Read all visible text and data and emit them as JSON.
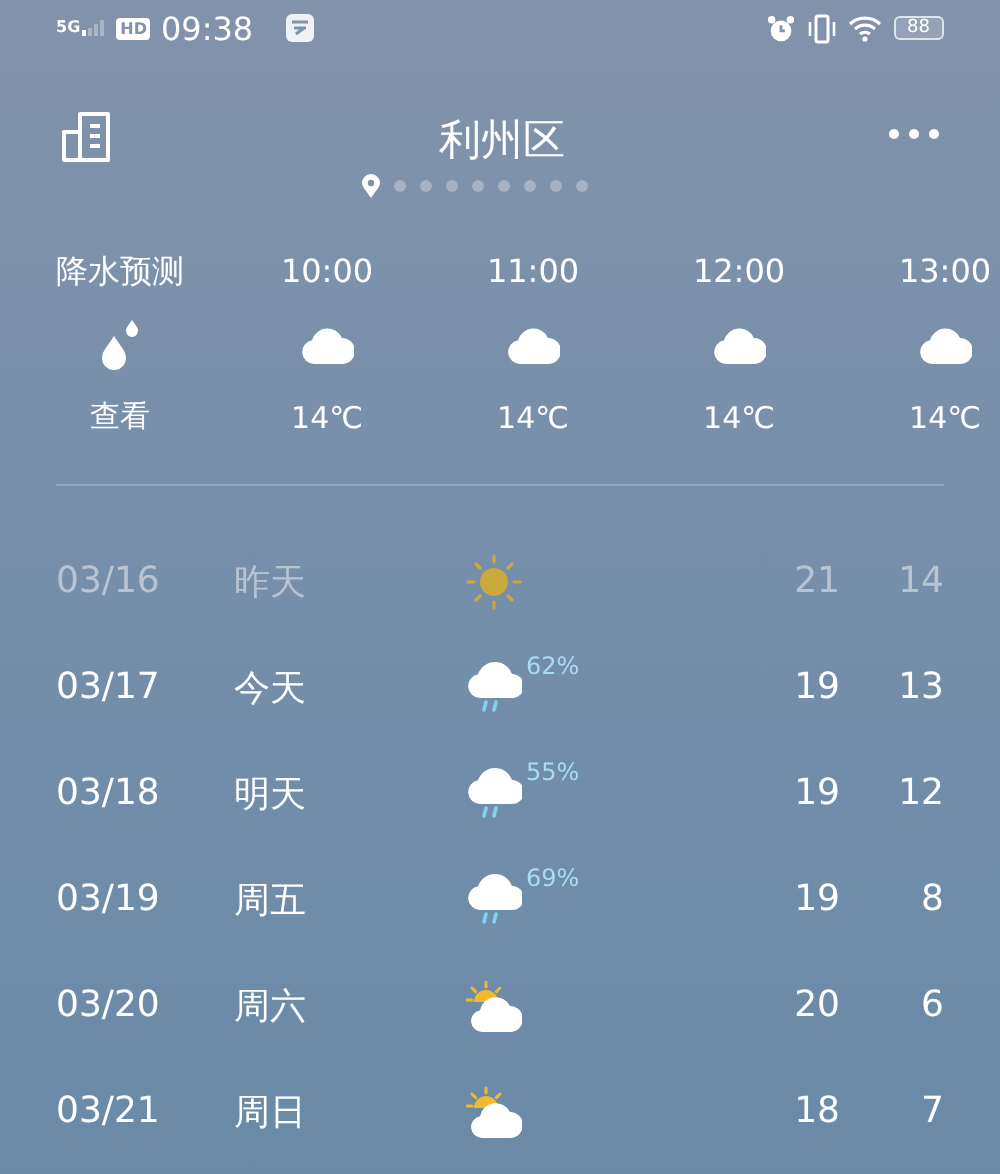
{
  "status_bar": {
    "network": "5G",
    "hd": "HD",
    "time": "09:38",
    "battery": "88"
  },
  "header": {
    "city": "利州区",
    "pages": [
      {
        "kind": "location",
        "selected": true
      },
      {
        "kind": "dot",
        "selected": false
      },
      {
        "kind": "dot",
        "selected": false
      },
      {
        "kind": "dot",
        "selected": false
      },
      {
        "kind": "dot",
        "selected": false
      },
      {
        "kind": "dot",
        "selected": false
      },
      {
        "kind": "dot",
        "selected": false
      },
      {
        "kind": "dot",
        "selected": false
      },
      {
        "kind": "dot",
        "selected": false
      }
    ]
  },
  "precipitation": {
    "label": "降水预测",
    "action": "查看"
  },
  "hourly": [
    {
      "time": "10:00",
      "kind": "cloudy",
      "temp": "14℃"
    },
    {
      "time": "11:00",
      "kind": "cloudy",
      "temp": "14℃"
    },
    {
      "time": "12:00",
      "kind": "cloudy",
      "temp": "14℃"
    },
    {
      "time": "13:00",
      "kind": "cloudy",
      "temp": "14℃"
    }
  ],
  "daily": [
    {
      "date": "03/16",
      "day": "昨天",
      "kind": "sunny",
      "past": true,
      "high": "21",
      "low": "14"
    },
    {
      "date": "03/17",
      "day": "今天",
      "kind": "rain",
      "past": false,
      "chance": "62%",
      "high": "19",
      "low": "13"
    },
    {
      "date": "03/18",
      "day": "明天",
      "kind": "rain",
      "past": false,
      "chance": "55%",
      "high": "19",
      "low": "12"
    },
    {
      "date": "03/19",
      "day": "周五",
      "kind": "rain",
      "past": false,
      "chance": "69%",
      "high": "19",
      "low": "8"
    },
    {
      "date": "03/20",
      "day": "周六",
      "kind": "partly_cloudy",
      "past": false,
      "high": "20",
      "low": "6"
    },
    {
      "date": "03/21",
      "day": "周日",
      "kind": "partly_cloudy",
      "past": false,
      "high": "18",
      "low": "7"
    }
  ]
}
